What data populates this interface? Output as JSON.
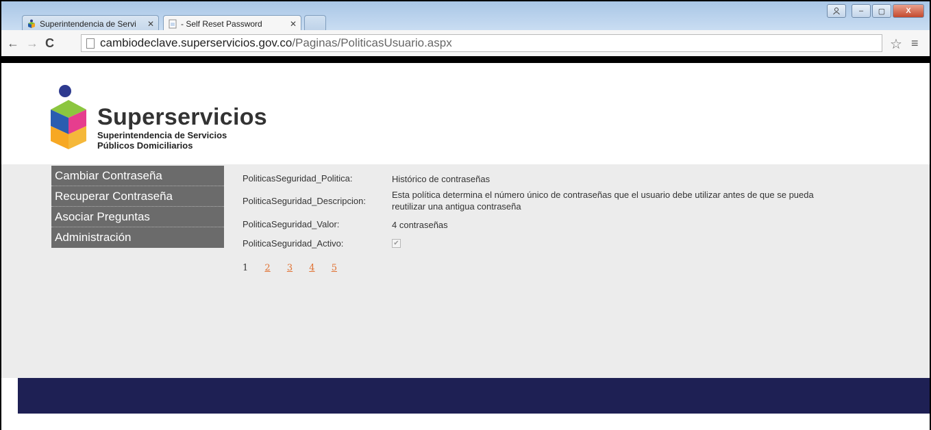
{
  "browser": {
    "tabs": [
      {
        "title": "Superintendencia de Servi",
        "close": "✕"
      },
      {
        "title": "- Self Reset Password",
        "close": "✕"
      }
    ],
    "url_host": "cambiodeclave.superservicios.gov.co",
    "url_path": "/Paginas/PoliticasUsuario.aspx",
    "win_min": "–",
    "win_max": "▢",
    "win_close": "X",
    "back": "←",
    "forward": "→",
    "reload": "C",
    "star": "☆",
    "menu": "≡"
  },
  "logo": {
    "name": "Superservicios",
    "line1": "Superintendencia de Servicios",
    "line2": "Públicos Domiciliarios"
  },
  "menu": [
    {
      "label": "Cambiar Contraseña"
    },
    {
      "label": "Recuperar Contraseña"
    },
    {
      "label": "Asociar Preguntas"
    },
    {
      "label": "Administración"
    }
  ],
  "policy": {
    "politica_label": "PoliticasSeguridad_Politica:",
    "politica_value": "Histórico de contraseñas",
    "descripcion_label": "PoliticaSeguridad_Descripcion:",
    "descripcion_value": "Esta política determina el número único de contraseñas que el usuario debe utilizar antes de que se pueda reutilizar una antigua contraseña",
    "valor_label": "PoliticaSeguridad_Valor:",
    "valor_value": "4 contraseñas",
    "activo_label": "PoliticaSeguridad_Activo:",
    "activo_checked": true,
    "activo_mark": "✔"
  },
  "pager": {
    "current": "1",
    "pages": [
      "2",
      "3",
      "4",
      "5"
    ]
  },
  "colors": {
    "footer": "#1e2054",
    "content_bg": "#ececec",
    "menu_bg": "#6b6b6b",
    "pager_link": "#e07030"
  }
}
